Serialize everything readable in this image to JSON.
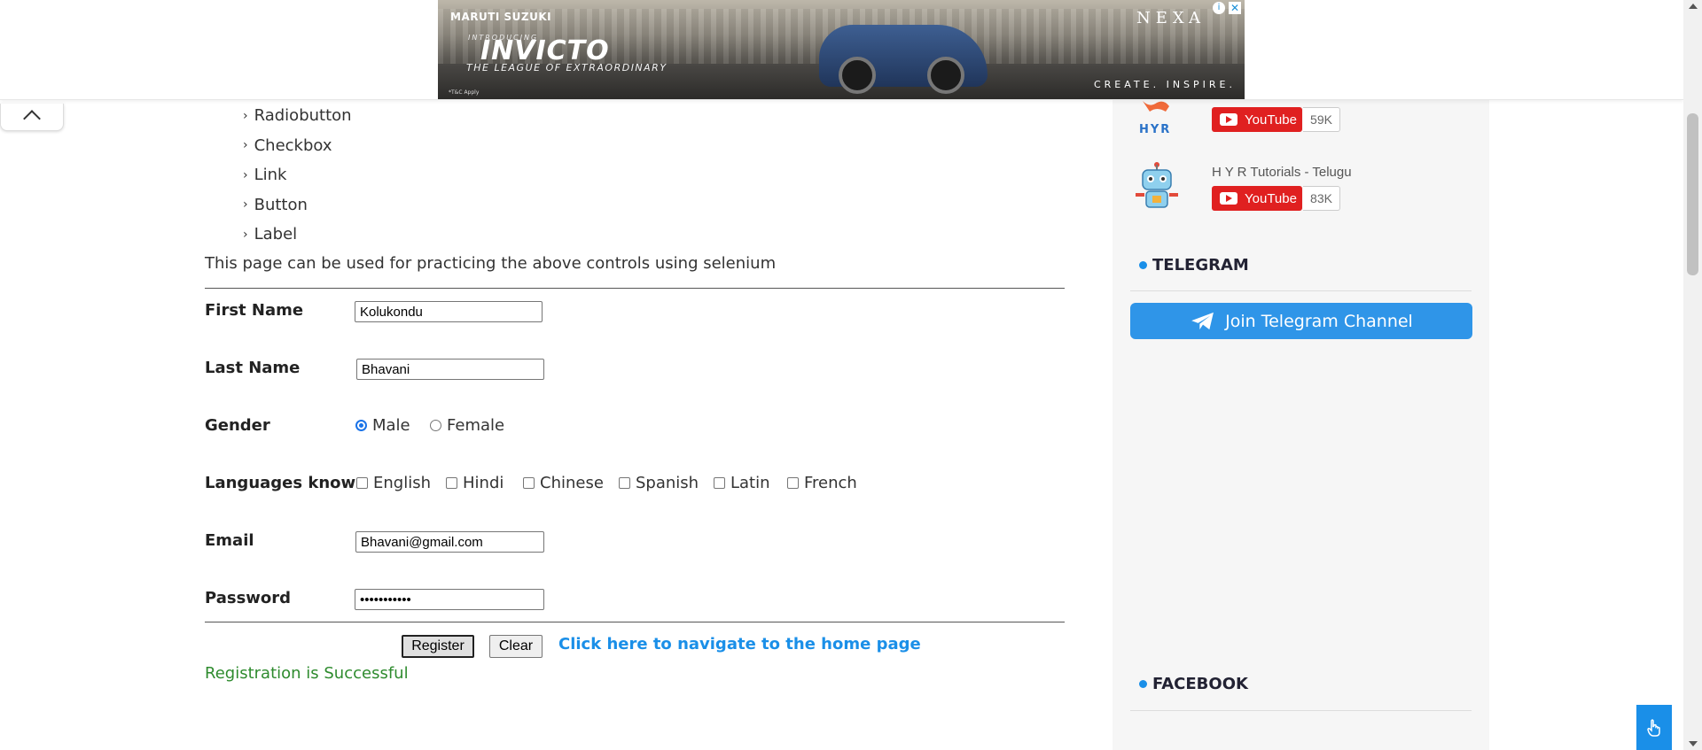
{
  "ad": {
    "brand": "MARUTI SUZUKI",
    "intro": "INTRODUCING",
    "model": "INVICTO",
    "tagline": "THE LEAGUE OF EXTRAORDINARY",
    "nexa": "NEXA",
    "slogan": "CREATE. INSPIRE.",
    "fine_print": "*T&C Apply"
  },
  "toc": [
    "Radiobutton",
    "Checkbox",
    "Link",
    "Button",
    "Label"
  ],
  "intro_text": "This page can be used for practicing the above controls using selenium",
  "form": {
    "first_name_label": "First Name",
    "first_name_value": "Kolukondu",
    "last_name_label": "Last Name",
    "last_name_value": "Bhavani",
    "gender_label": "Gender",
    "gender_options": [
      "Male",
      "Female"
    ],
    "gender_selected": "Male",
    "languages_label": "Languages known",
    "languages": [
      "English",
      "Hindi",
      "Chinese",
      "Spanish",
      "Latin",
      "French"
    ],
    "email_label": "Email",
    "email_value": "Bhavani@gmail.com",
    "password_label": "Password",
    "password_value": "•••••••••••",
    "register_label": "Register",
    "clear_label": "Clear",
    "home_link": "Click here to navigate to the home page",
    "success_message": "Registration is Successful"
  },
  "sidebar": {
    "channels": [
      {
        "name": "",
        "button": "YouTube",
        "count": "59K"
      },
      {
        "name": "H Y R Tutorials - Telugu",
        "button": "YouTube",
        "count": "83K"
      }
    ],
    "telegram_heading": "TELEGRAM",
    "telegram_button": "Join Telegram Channel",
    "facebook_heading": "FACEBOOK",
    "hyr_logo_text": "HYR"
  },
  "colors": {
    "accent": "#1a8fe8",
    "youtube_red": "#e02020",
    "success_green": "#2e8b2e",
    "telegram_blue": "#2f95e8"
  },
  "icons": [
    "chevron-up-icon",
    "info-icon",
    "close-icon",
    "youtube-play-icon",
    "telegram-plane-icon",
    "hand-pointer-icon",
    "robot-icon"
  ]
}
